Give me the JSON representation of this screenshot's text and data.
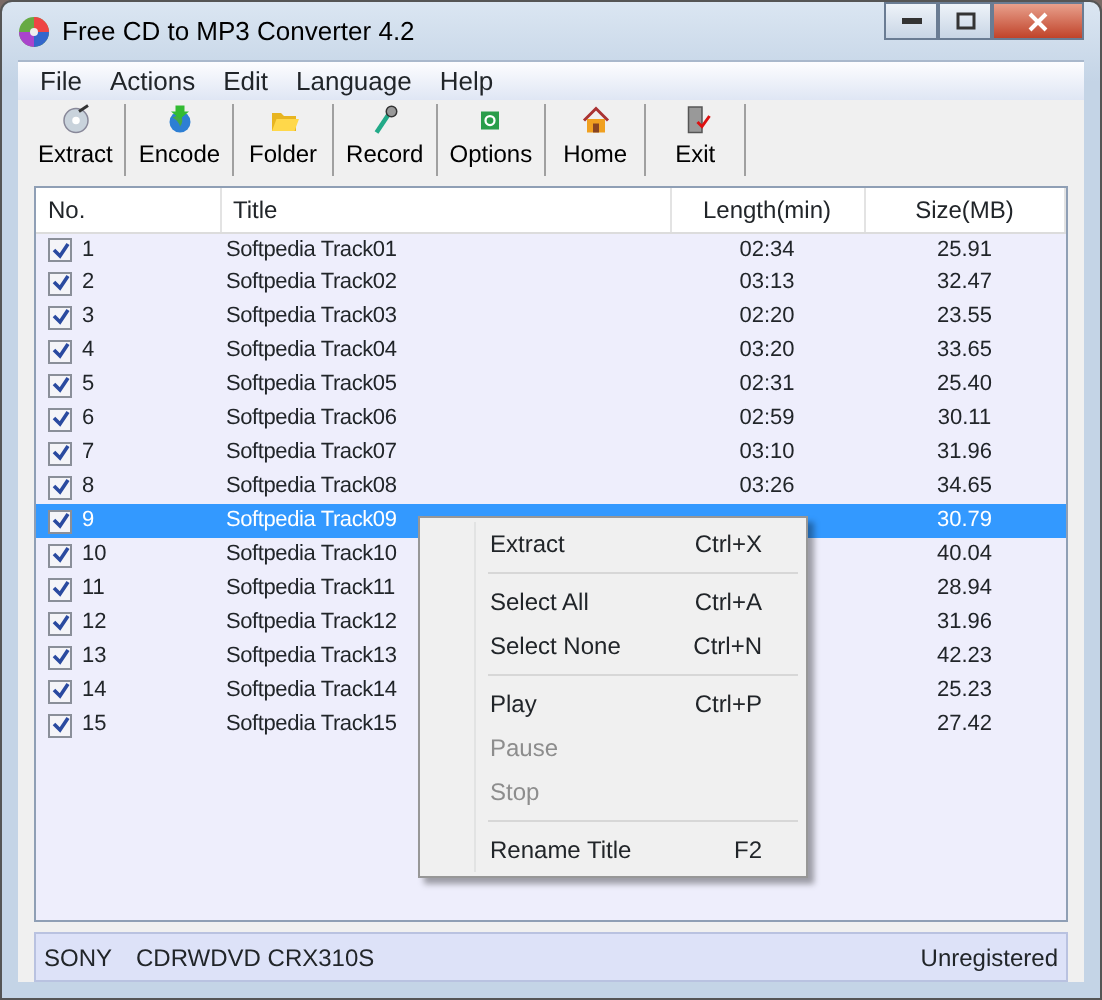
{
  "window": {
    "title": "Free CD to MP3 Converter 4.2"
  },
  "menu": [
    "File",
    "Actions",
    "Edit",
    "Language",
    "Help"
  ],
  "toolbar": [
    {
      "label": "Extract",
      "kind": "extract"
    },
    {
      "label": "Encode",
      "kind": "encode"
    },
    {
      "label": "Folder",
      "kind": "folder"
    },
    {
      "label": "Record",
      "kind": "record"
    },
    {
      "label": "Options",
      "kind": "options"
    },
    {
      "label": "Home",
      "kind": "home"
    },
    {
      "label": "Exit",
      "kind": "exit"
    }
  ],
  "table": {
    "columns": [
      "No.",
      "Title",
      "Length(min)",
      "Size(MB)"
    ],
    "rows": [
      {
        "no": "1",
        "title": "Softpedia Track01",
        "length": "02:34",
        "size": "25.91",
        "checked": true,
        "selected": false
      },
      {
        "no": "2",
        "title": "Softpedia Track02",
        "length": "03:13",
        "size": "32.47",
        "checked": true,
        "selected": false
      },
      {
        "no": "3",
        "title": "Softpedia Track03",
        "length": "02:20",
        "size": "23.55",
        "checked": true,
        "selected": false
      },
      {
        "no": "4",
        "title": "Softpedia Track04",
        "length": "03:20",
        "size": "33.65",
        "checked": true,
        "selected": false
      },
      {
        "no": "5",
        "title": "Softpedia Track05",
        "length": "02:31",
        "size": "25.40",
        "checked": true,
        "selected": false
      },
      {
        "no": "6",
        "title": "Softpedia Track06",
        "length": "02:59",
        "size": "30.11",
        "checked": true,
        "selected": false
      },
      {
        "no": "7",
        "title": "Softpedia Track07",
        "length": "03:10",
        "size": "31.96",
        "checked": true,
        "selected": false
      },
      {
        "no": "8",
        "title": "Softpedia Track08",
        "length": "03:26",
        "size": "34.65",
        "checked": true,
        "selected": false
      },
      {
        "no": "9",
        "title": "Softpedia Track09",
        "size": "30.79",
        "checked": true,
        "selected": true
      },
      {
        "no": "10",
        "title": "Softpedia Track10",
        "size": "40.04",
        "checked": true,
        "selected": false
      },
      {
        "no": "11",
        "title": "Softpedia Track11",
        "size": "28.94",
        "checked": true,
        "selected": false
      },
      {
        "no": "12",
        "title": "Softpedia Track12",
        "size": "31.96",
        "checked": true,
        "selected": false
      },
      {
        "no": "13",
        "title": "Softpedia Track13",
        "size": "42.23",
        "checked": true,
        "selected": false
      },
      {
        "no": "14",
        "title": "Softpedia Track14",
        "size": "25.23",
        "checked": true,
        "selected": false
      },
      {
        "no": "15",
        "title": "Softpedia Track15",
        "size": "27.42",
        "checked": true,
        "selected": false
      }
    ]
  },
  "context_menu": {
    "items": [
      {
        "kind": "item",
        "label": "Extract",
        "shortcut": "Ctrl+X",
        "disabled": false
      },
      {
        "kind": "separator"
      },
      {
        "kind": "item",
        "label": "Select All",
        "shortcut": "Ctrl+A",
        "disabled": false
      },
      {
        "kind": "item",
        "label": "Select None",
        "shortcut": "Ctrl+N",
        "disabled": false
      },
      {
        "kind": "separator"
      },
      {
        "kind": "item",
        "label": "Play",
        "shortcut": "Ctrl+P",
        "disabled": false
      },
      {
        "kind": "item",
        "label": "Pause",
        "disabled": true
      },
      {
        "kind": "item",
        "label": "Stop",
        "disabled": true
      },
      {
        "kind": "separator"
      },
      {
        "kind": "item",
        "label": "Rename Title",
        "shortcut": "F2",
        "disabled": false
      }
    ]
  },
  "status_bar": {
    "drive_vendor": "SONY",
    "drive_model": "CDRWDVD CRX310S",
    "registration": "Unregistered"
  }
}
